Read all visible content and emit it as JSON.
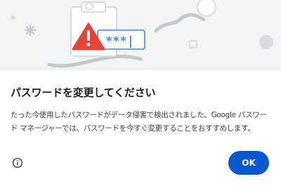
{
  "dialog": {
    "illustration": {
      "masked_password": "***|",
      "icons": [
        "clipboard-icon",
        "warning-icon",
        "sparkle-icon"
      ]
    },
    "title": "パスワードを変更してください",
    "message": "たった今使用したパスワードがデータ侵害で検出されました。Google パスワード マネージャーでは、パスワードを今すぐ変更することをおすすめします。",
    "ok_label": "OK",
    "info_icon": "info-icon"
  },
  "colors": {
    "accent": "#0b57d0",
    "warning": "#e84335",
    "illustration_blue": "#4285f4",
    "banner_bg": "#f1f3f4"
  }
}
